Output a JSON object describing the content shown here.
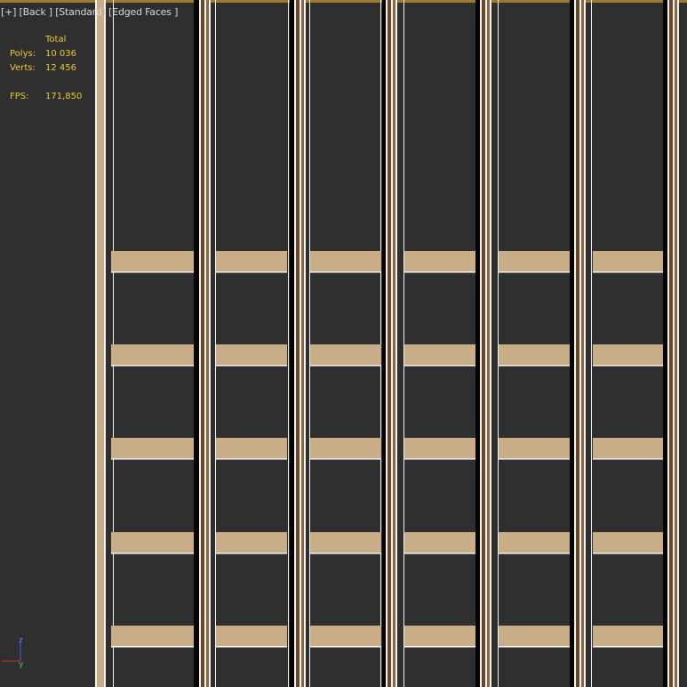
{
  "viewport": {
    "label_parts": [
      "[+]",
      "[Back ]",
      "[Standard]",
      "[Edged Faces ]"
    ]
  },
  "stats": {
    "header": "Total",
    "polys_label": "Polys:",
    "polys_value": "10 036",
    "verts_label": "Verts:",
    "verts_value": "12 456",
    "fps_label": "FPS:",
    "fps_value": "171,850"
  },
  "gizmo": {
    "z_label": "z",
    "y_label": "y"
  },
  "colors": {
    "background": "#2f2f2f",
    "wood_light": "#c9ad86",
    "wood_dark": "#6b4727",
    "edge_white": "#f2f2f2",
    "stats_text": "#e8c83a"
  }
}
